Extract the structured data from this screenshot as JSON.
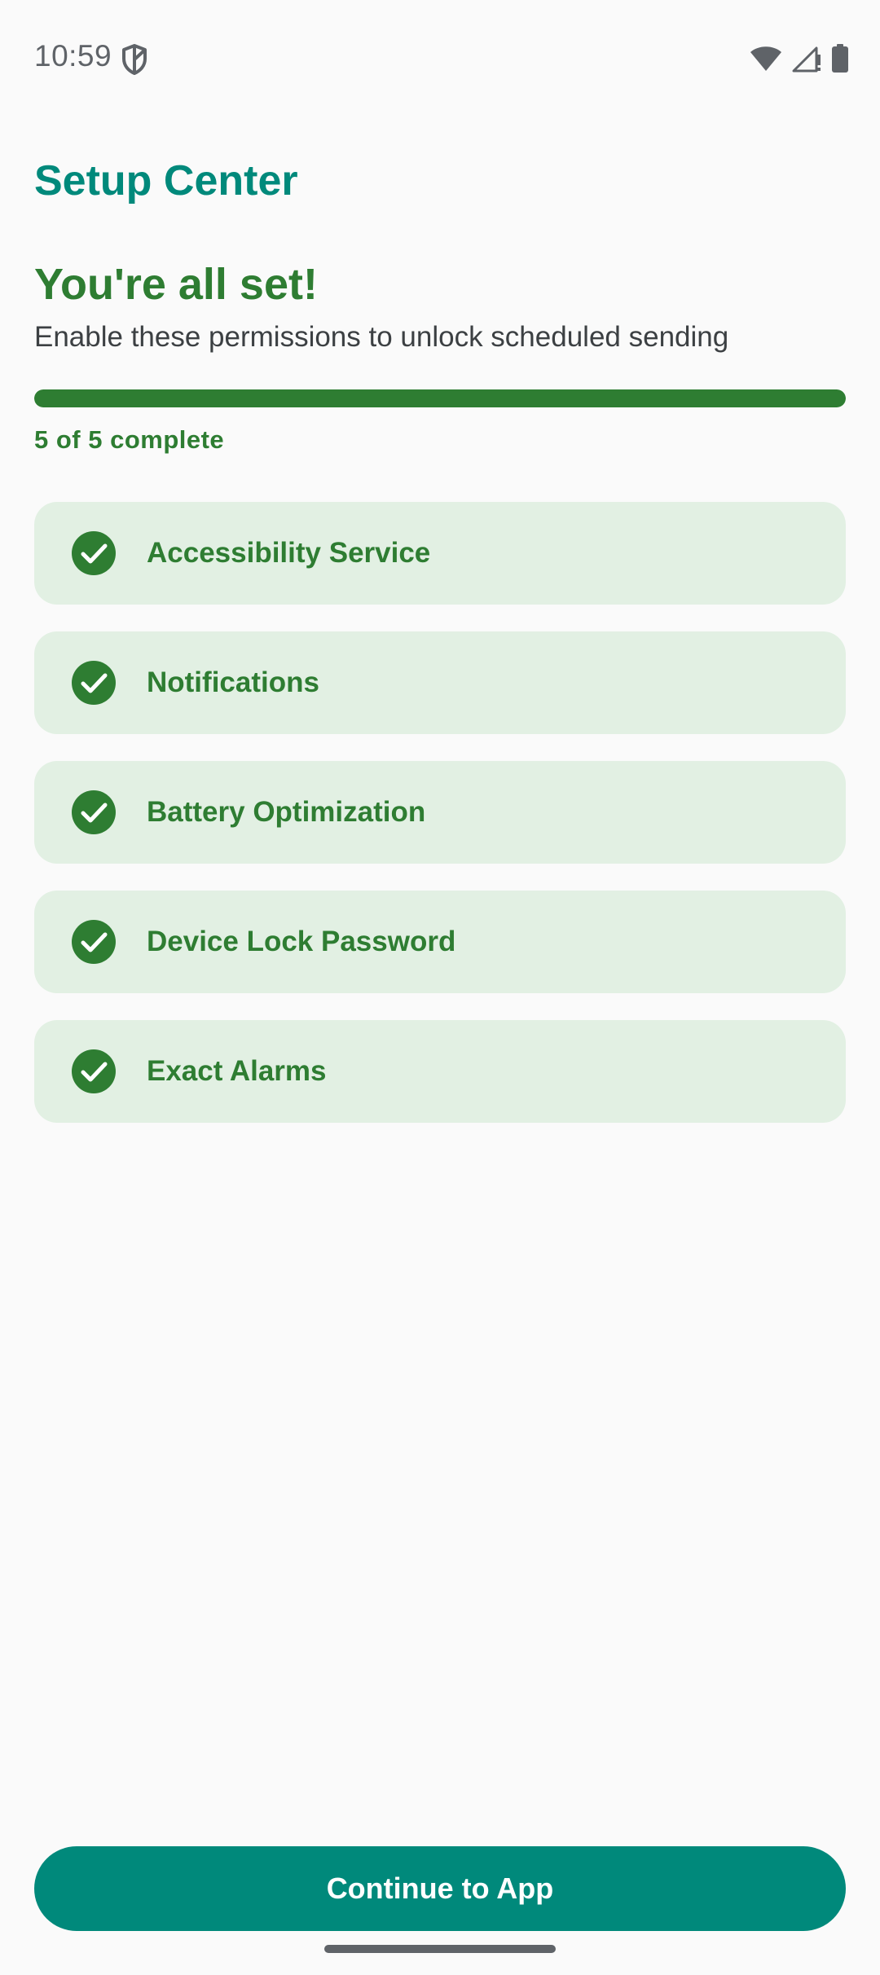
{
  "status_bar": {
    "time": "10:59",
    "icons": [
      "shield-icon",
      "wifi-icon",
      "cell-signal-icon",
      "battery-icon"
    ]
  },
  "header": {
    "title": "Setup Center"
  },
  "main": {
    "headline": "You're all set!",
    "subtitle": "Enable these permissions to unlock scheduled sending",
    "progress": {
      "completed": 5,
      "total": 5,
      "fraction": 1.0,
      "label": "5 of 5 complete"
    },
    "permissions": [
      {
        "label": "Accessibility Service",
        "status": "complete",
        "icon": "check-circle-icon"
      },
      {
        "label": "Notifications",
        "status": "complete",
        "icon": "check-circle-icon"
      },
      {
        "label": "Battery Optimization",
        "status": "complete",
        "icon": "check-circle-icon"
      },
      {
        "label": "Device Lock Password",
        "status": "complete",
        "icon": "check-circle-icon"
      },
      {
        "label": "Exact Alarms",
        "status": "complete",
        "icon": "check-circle-icon"
      }
    ]
  },
  "footer": {
    "continue_label": "Continue to App"
  },
  "colors": {
    "title_teal": "#00897b",
    "success_green": "#2e7d32",
    "card_background": "#e2f0e3",
    "button_background": "#00897b",
    "page_background": "#fafafa"
  }
}
